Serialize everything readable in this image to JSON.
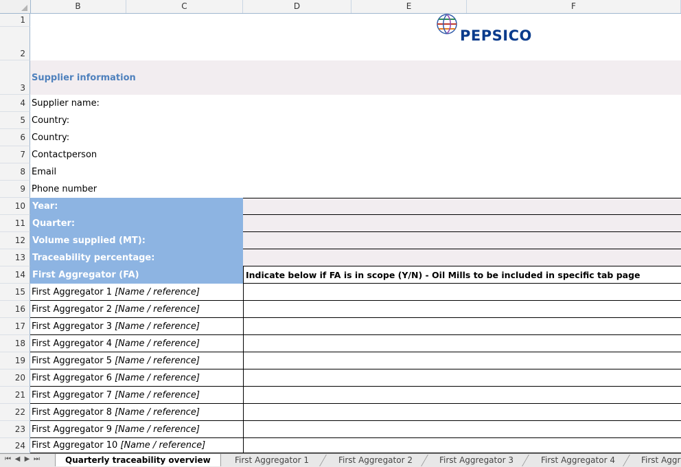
{
  "columns": [
    "B",
    "C",
    "D",
    "E",
    "F"
  ],
  "rows": [
    "1",
    "2",
    "3",
    "4",
    "5",
    "6",
    "7",
    "8",
    "9",
    "10",
    "11",
    "12",
    "13",
    "14",
    "15",
    "16",
    "17",
    "18",
    "19",
    "20",
    "21",
    "22",
    "23",
    "24"
  ],
  "logo": {
    "text": "PEPSICO"
  },
  "section_title": "Supplier information",
  "supplier_fields": [
    "Supplier name:",
    "Country:",
    "Country:",
    "Contactperson",
    "Email",
    "Phone number"
  ],
  "period_fields": [
    "Year:",
    "Quarter:",
    "Volume supplied (MT):",
    "Traceability percentage:"
  ],
  "fa_header": "First Aggregator (FA)",
  "fa_instruction": "Indicate below if FA is in scope (Y/N) - Oil Mills to be included in specific tab page",
  "aggregators": [
    {
      "name": "First Aggregator 1",
      "ref": "[Name / reference]"
    },
    {
      "name": "First Aggregator 2",
      "ref": "[Name / reference]"
    },
    {
      "name": "First Aggregator 3",
      "ref": "[Name / reference]"
    },
    {
      "name": "First Aggregator 4",
      "ref": "[Name / reference]"
    },
    {
      "name": "First Aggregator 5",
      "ref": "[Name / reference]"
    },
    {
      "name": "First Aggregator 6",
      "ref": "[Name / reference]"
    },
    {
      "name": "First Aggregator 7",
      "ref": "[Name / reference]"
    },
    {
      "name": "First Aggregator 8",
      "ref": "[Name / reference]"
    },
    {
      "name": "First Aggregator 9",
      "ref": "[Name / reference]"
    },
    {
      "name": "First Aggregator 10",
      "ref": "[Name / reference]"
    }
  ],
  "tabs": [
    "Quarterly traceability overview",
    "First Aggregator 1",
    "First Aggregator 2",
    "First Aggregator 3",
    "First Aggregator 4",
    "First Aggr"
  ],
  "active_tab": 0,
  "colors": {
    "header_blue": "#8db4e2",
    "title_blue": "#4f81bd",
    "pink_band": "#f2edf0",
    "logo_blue": "#0a3b8c"
  }
}
